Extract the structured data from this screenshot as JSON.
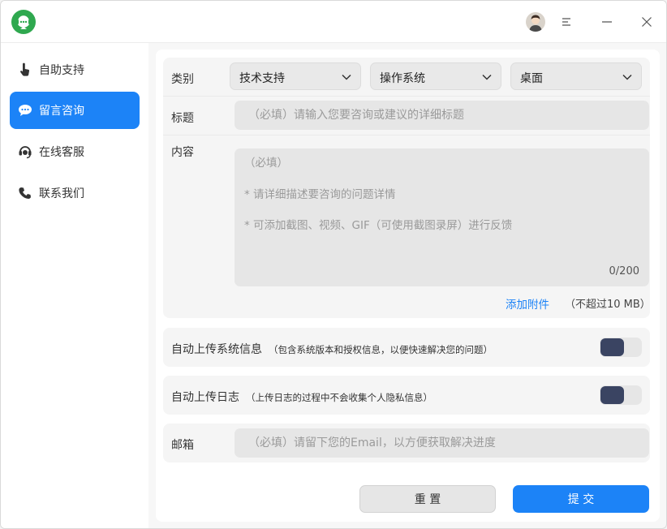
{
  "nav": {
    "items": [
      {
        "label": "自助支持",
        "icon": "tap-hand-icon"
      },
      {
        "label": "留言咨询",
        "icon": "chat-bubble-icon"
      },
      {
        "label": "在线客服",
        "icon": "headset-icon"
      },
      {
        "label": "联系我们",
        "icon": "phone-icon"
      }
    ],
    "active_index": 1
  },
  "form": {
    "category": {
      "label": "类别",
      "selects": [
        "技术支持",
        "操作系统",
        "桌面"
      ]
    },
    "title": {
      "label": "标题",
      "placeholder": "（必填）请输入您要咨询或建议的详细标题"
    },
    "content": {
      "label": "内容",
      "placeholder_lines": [
        "（必填）",
        "* 请详细描述要咨询的问题详情",
        "* 可添加截图、视频、GIF（可使用截图录屏）进行反馈"
      ],
      "counter": "0/200",
      "attach_label": "添加附件",
      "attach_note": "（不超过10 MB）"
    },
    "upload_sysinfo": {
      "label": "自动上传系统信息",
      "hint": "（包含系统版本和授权信息，以便快速解决您的问题）",
      "on": true
    },
    "upload_logs": {
      "label": "自动上传日志",
      "hint": "（上传日志的过程中不会收集个人隐私信息）",
      "on": true
    },
    "email": {
      "label": "邮箱",
      "placeholder": "（必填）请留下您的Email，以方便获取解决进度"
    }
  },
  "actions": {
    "reset_label": "重 置",
    "submit_label": "提 交"
  },
  "colors": {
    "accent": "#1c83f7",
    "toggle_knob": "#3a4462",
    "logo_green": "#2fa84f"
  }
}
